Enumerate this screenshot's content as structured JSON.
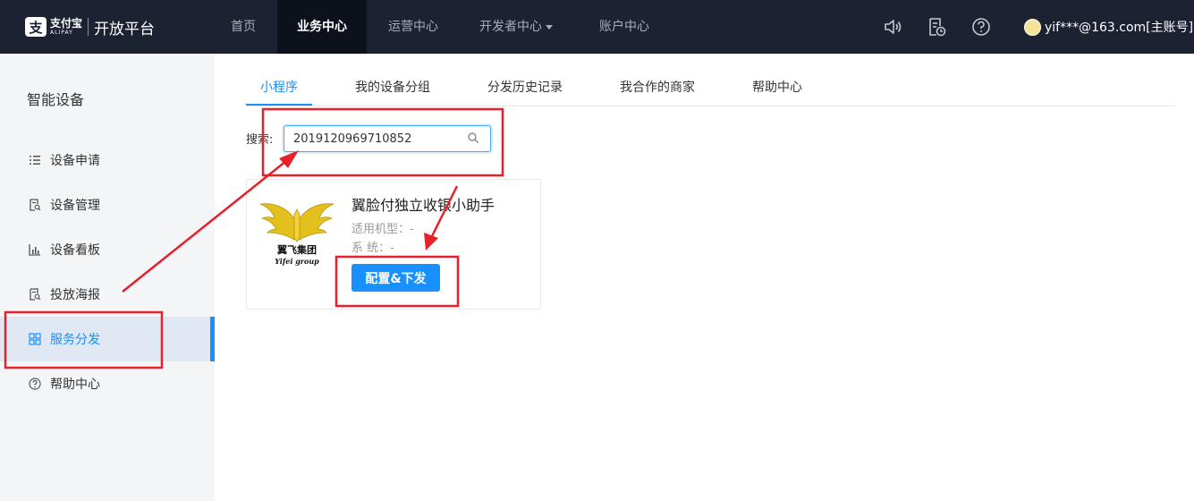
{
  "header": {
    "logo_mark": "支",
    "logo_cn": "支付宝",
    "logo_en": "ALIPAY",
    "logo_title": "开放平台",
    "nav": [
      {
        "label": "首页"
      },
      {
        "label": "业务中心"
      },
      {
        "label": "运营中心"
      },
      {
        "label": "开发者中心"
      },
      {
        "label": "账户中心"
      }
    ],
    "user": "yif***@163.com[主账号]"
  },
  "sidebar": {
    "title": "智能设备",
    "items": [
      {
        "label": "设备申请"
      },
      {
        "label": "设备管理"
      },
      {
        "label": "设备看板"
      },
      {
        "label": "投放海报"
      },
      {
        "label": "服务分发"
      },
      {
        "label": "帮助中心"
      }
    ]
  },
  "tabs": [
    {
      "label": "小程序"
    },
    {
      "label": "我的设备分组"
    },
    {
      "label": "分发历史记录"
    },
    {
      "label": "我合作的商家"
    },
    {
      "label": "帮助中心"
    }
  ],
  "search": {
    "label": "搜索:",
    "value": "2019120969710852"
  },
  "card": {
    "logo_cn": "翼飞集团",
    "logo_en": "Yifei group",
    "title": "翼脸付独立收银小助手",
    "meta1": "适用机型：-",
    "meta2": "系 统：-",
    "button": "配置&下发"
  },
  "colors": {
    "topbar": "#1d2233",
    "accent": "#1890ff",
    "annotation": "#e8202a"
  }
}
